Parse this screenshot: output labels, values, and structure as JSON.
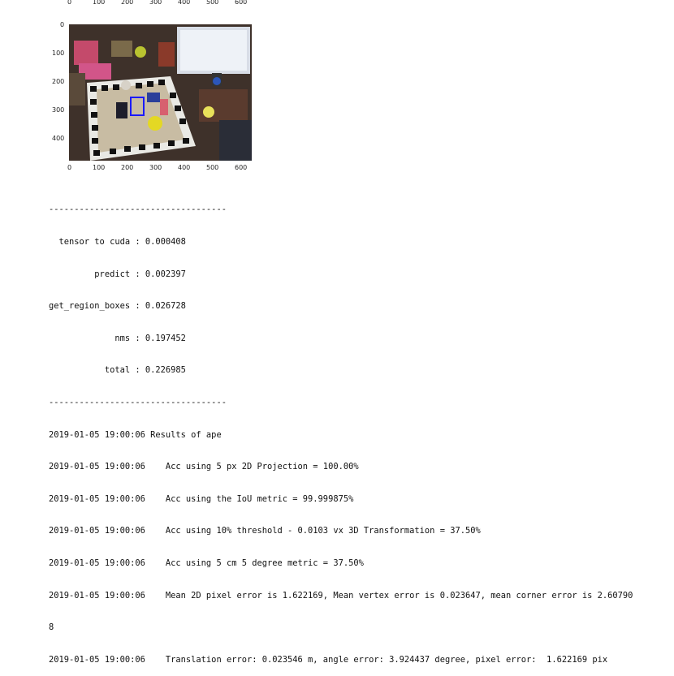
{
  "figure": {
    "top_axis_ticks": [
      "0",
      "100",
      "200",
      "300",
      "400",
      "500",
      "600"
    ],
    "bottom_axis_ticks": [
      "0",
      "100",
      "200",
      "300",
      "400",
      "500",
      "600"
    ],
    "left_axis_ticks": [
      "0",
      "100",
      "200",
      "300",
      "400"
    ],
    "bounding_box_color": "#1a1aff"
  },
  "console": {
    "lines": [
      "-----------------------------------",
      "  tensor to cuda : 0.000408",
      "         predict : 0.002397",
      "get_region_boxes : 0.026728",
      "             nms : 0.197452",
      "           total : 0.226985",
      "-----------------------------------",
      "2019-01-05 19:00:06 Results of ape",
      "2019-01-05 19:00:06    Acc using 5 px 2D Projection = 100.00%",
      "2019-01-05 19:00:06    Acc using the IoU metric = 99.999875%",
      "2019-01-05 19:00:06    Acc using 10% threshold - 0.0103 vx 3D Transformation = 37.50%",
      "2019-01-05 19:00:06    Acc using 5 cm 5 degree metric = 37.50%",
      "2019-01-05 19:00:06    Mean 2D pixel error is 1.622169, Mean vertex error is 0.023647, mean corner error is 2.60790",
      "8",
      "2019-01-05 19:00:06    Translation error: 0.023546 m, angle error: 3.924437 degree, pixel error:  1.622169 pix"
    ]
  }
}
